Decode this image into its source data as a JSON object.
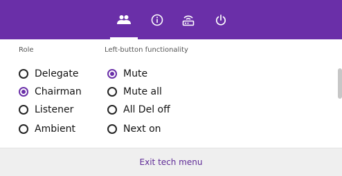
{
  "colors": {
    "header": "#6a2fa8",
    "accent": "#6a2fa8",
    "footer_bg": "#efefef"
  },
  "tabs": [
    {
      "icon": "people-icon",
      "active": true
    },
    {
      "icon": "info-icon",
      "active": false
    },
    {
      "icon": "router-icon",
      "active": false
    },
    {
      "icon": "power-icon",
      "active": false
    }
  ],
  "role": {
    "label": "Role",
    "options": [
      {
        "label": "Delegate",
        "selected": false
      },
      {
        "label": "Chairman",
        "selected": true
      },
      {
        "label": "Listener",
        "selected": false
      },
      {
        "label": "Ambient",
        "selected": false
      }
    ]
  },
  "left_button": {
    "label": "Left-button functionality",
    "options": [
      {
        "label": "Mute",
        "selected": true
      },
      {
        "label": "Mute all",
        "selected": false
      },
      {
        "label": "All Del off",
        "selected": false
      },
      {
        "label": "Next on",
        "selected": false
      }
    ]
  },
  "footer": {
    "exit_label": "Exit tech menu"
  }
}
